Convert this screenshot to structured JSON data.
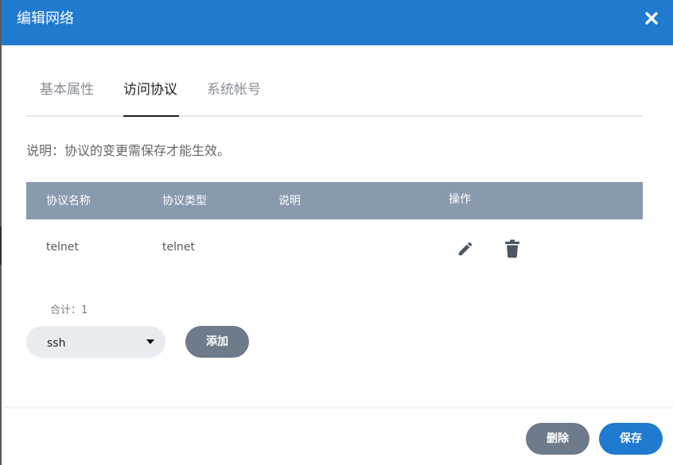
{
  "dialog": {
    "title": "编辑网络",
    "close_icon": "close-icon",
    "header_color": "#1f7ad0"
  },
  "tabs": [
    {
      "label": "基本属性",
      "active": false
    },
    {
      "label": "访问协议",
      "active": true
    },
    {
      "label": "系统帐号",
      "active": false
    }
  ],
  "note": "说明：协议的变更需保存才能生效。",
  "table": {
    "headers": [
      "协议名称",
      "协议类型",
      "说明",
      "操作"
    ],
    "rows": [
      {
        "name": "telnet",
        "type": "telnet",
        "description": "",
        "actions": [
          "edit-icon",
          "trash-icon"
        ]
      }
    ]
  },
  "total_label": "合计：1",
  "protocol_select": {
    "value": "ssh"
  },
  "add_button": "添加",
  "footer": {
    "delete_button": "删除",
    "save_button": "保存"
  }
}
